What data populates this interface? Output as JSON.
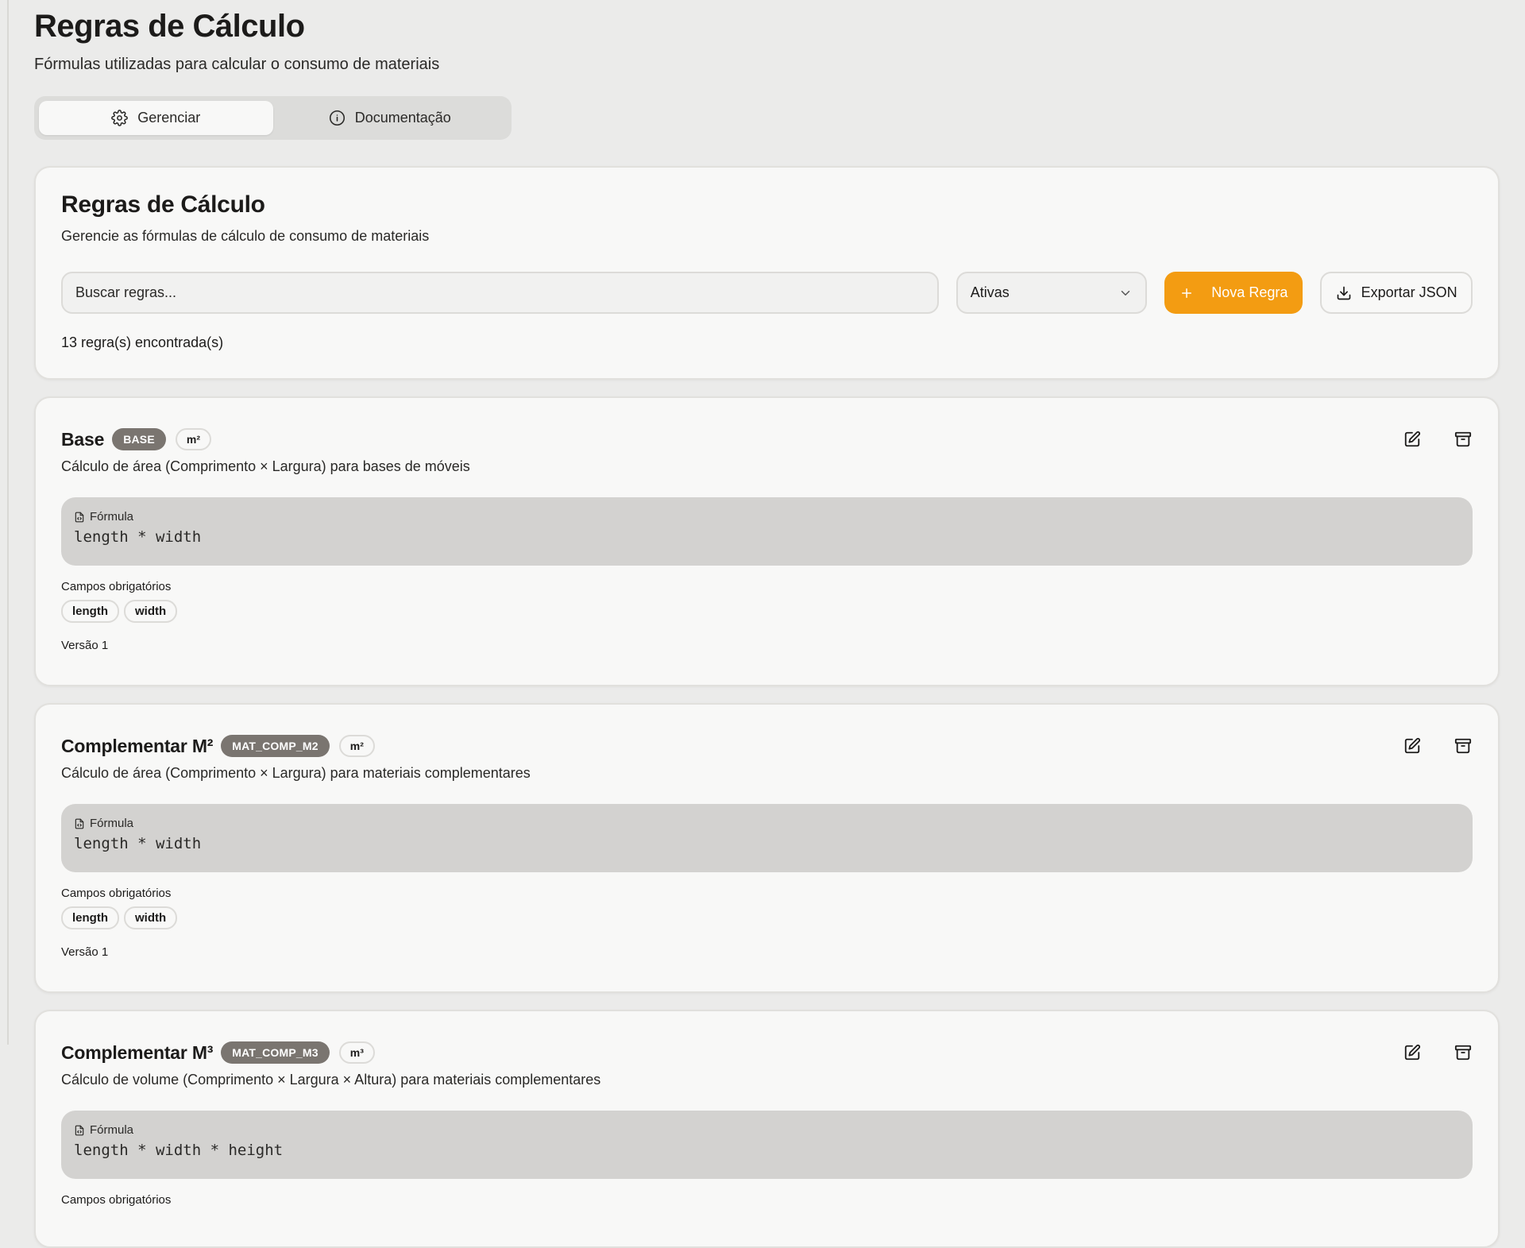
{
  "page": {
    "title": "Regras de Cálculo",
    "subtitle": "Fórmulas utilizadas para calcular o consumo de materiais"
  },
  "tabs": [
    {
      "label": "Gerenciar",
      "icon": "gear-icon",
      "active": true
    },
    {
      "label": "Documentação",
      "icon": "info-icon",
      "active": false
    }
  ],
  "manager": {
    "title": "Regras de Cálculo",
    "description": "Gerencie as fórmulas de cálculo de consumo de materiais",
    "search_placeholder": "Buscar regras...",
    "status_filter": "Ativas",
    "new_rule_label": "Nova Regra",
    "export_label": "Exportar JSON",
    "count_text": "13 regra(s) encontrada(s)"
  },
  "labels": {
    "formula": "Fórmula",
    "required_fields": "Campos obrigatórios"
  },
  "colors": {
    "accent": "#f39c12",
    "badge_dark": "#7a7570",
    "formula_bg": "#d3d2d0",
    "background": "#ebebea"
  },
  "rules": [
    {
      "name": "Base",
      "code": "BASE",
      "unit": "m²",
      "description": "Cálculo de área (Comprimento × Largura) para bases de móveis",
      "formula": "length * width",
      "fields": [
        "length",
        "width"
      ],
      "version": "Versão 1"
    },
    {
      "name": "Complementar M²",
      "code": "MAT_COMP_M2",
      "unit": "m²",
      "description": "Cálculo de área (Comprimento × Largura) para materiais complementares",
      "formula": "length * width",
      "fields": [
        "length",
        "width"
      ],
      "version": "Versão 1"
    },
    {
      "name": "Complementar M³",
      "code": "MAT_COMP_M3",
      "unit": "m³",
      "description": "Cálculo de volume (Comprimento × Largura × Altura) para materiais complementares",
      "formula": "length * width * height",
      "fields_label": "Campos obrigatórios"
    }
  ]
}
